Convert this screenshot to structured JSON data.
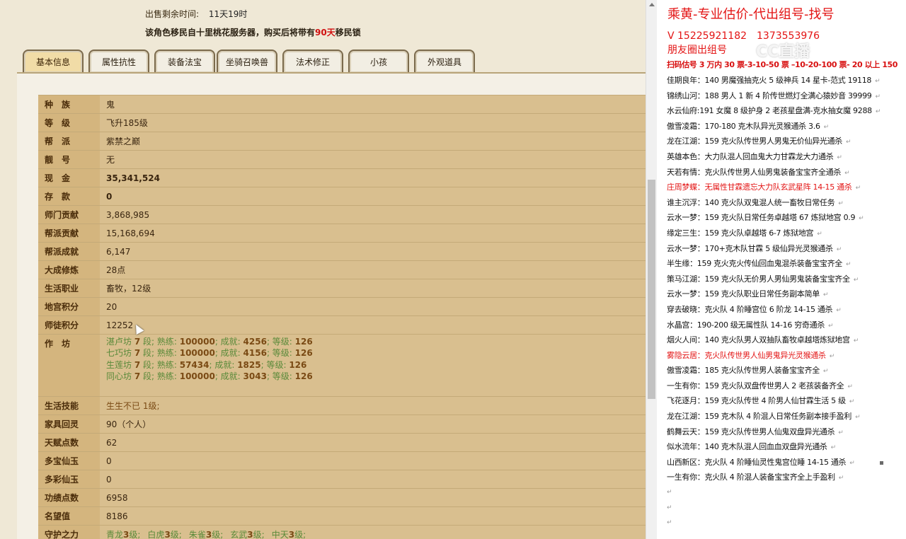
{
  "header": {
    "time_label": "出售剩余时间:",
    "time_value": "11天19时",
    "migration_prefix": "该角色移民自十里桃花服务器，购买后将带有",
    "migration_days": "90天",
    "migration_suffix": "移民锁"
  },
  "tabs": [
    "基本信息",
    "属性抗性",
    "装备法宝",
    "坐骑召唤兽",
    "法术修正",
    "小孩",
    "外观道具"
  ],
  "active_tab": 0,
  "rows": [
    {
      "key": "种　族",
      "value": "鬼"
    },
    {
      "key": "等　级",
      "value": "飞升185级"
    },
    {
      "key": "帮　派",
      "value": "紫禁之巅"
    },
    {
      "key": "靓　号",
      "value": "无"
    },
    {
      "key": "现　金",
      "value": "35,341,524"
    },
    {
      "key": "存　款",
      "value": "0"
    },
    {
      "key": "师门贡献",
      "value": "3,868,985"
    },
    {
      "key": "帮派贡献",
      "value": "15,168,694"
    },
    {
      "key": "帮派成就",
      "value": "6,147"
    },
    {
      "key": "大成修炼",
      "value": "28点"
    },
    {
      "key": "生活职业",
      "value": "畜牧，12级"
    },
    {
      "key": "地宫积分",
      "value": "20"
    },
    {
      "key": "师徒积分",
      "value": "12252"
    }
  ],
  "workshop": {
    "key": "作　坊",
    "lines": [
      {
        "name": "湛卢坊",
        "seg": "7",
        "seg_label": "段;",
        "skill_label": "熟练:",
        "skill": "100000",
        "ach_label": "成就:",
        "ach": "4256",
        "lv_label": "等级:",
        "lv": "126"
      },
      {
        "name": "七巧坊",
        "seg": "7",
        "seg_label": "段;",
        "skill_label": "熟练:",
        "skill": "100000",
        "ach_label": "成就:",
        "ach": "4156",
        "lv_label": "等级:",
        "lv": "126"
      },
      {
        "name": "生莲坊",
        "seg": "7",
        "seg_label": "段;",
        "skill_label": "熟练:",
        "skill": "57434",
        "ach_label": "成就:",
        "ach": "1825",
        "lv_label": "等级:",
        "lv": "126"
      },
      {
        "name": "同心坊",
        "seg": "7",
        "seg_label": "段;",
        "skill_label": "熟练:",
        "skill": "100000",
        "ach_label": "成就:",
        "ach": "3043",
        "lv_label": "等级:",
        "lv": "126"
      }
    ]
  },
  "rows2": [
    {
      "key": "生活技能",
      "value": "生生不已 1级;"
    },
    {
      "key": "家具回灵",
      "value": "90（个人）"
    },
    {
      "key": "天赋点数",
      "value": "62"
    },
    {
      "key": "多宝仙玉",
      "value": "0"
    },
    {
      "key": "多彩仙玉",
      "value": "0"
    },
    {
      "key": "功绩点数",
      "value": "6958"
    },
    {
      "key": "名望值",
      "value": "8186"
    }
  ],
  "guard": {
    "key": "守护之力",
    "items": [
      {
        "name": "青龙",
        "lv": "3",
        "unit": "级;"
      },
      {
        "name": "白虎",
        "lv": "3",
        "unit": "级;"
      },
      {
        "name": "朱雀",
        "lv": "3",
        "unit": "级;"
      },
      {
        "name": "玄武",
        "lv": "3",
        "unit": "级;"
      },
      {
        "name": "中天",
        "lv": "3",
        "unit": "级;"
      }
    ]
  },
  "notepad": {
    "title": "乘黄-专业估价-代出组号-找号",
    "phone": "V 15225921182　137​3553976",
    "moments": "朋友圈出组号",
    "watermark": "CC直播",
    "scan": "扫码估号 3 万内 30 票-3-10-50 票 –10-20-100 票- 20 以上 150",
    "para_mark": "↵",
    "lines": [
      {
        "text": "佳期良年：140 男魔强抽克火 5 级神兵 14 星卡-范式 19118",
        "red": false
      },
      {
        "text": "锦绣山河：188 男人 1 新 4 阶传世燃灯全满心猿妙音 39999",
        "red": false
      },
      {
        "text": "水云仙府:191 女魔 8 级护身 2 老孩星盘满-克水抽女魔 9288",
        "red": false
      },
      {
        "text": "傲雪凌霜：170-180 克木队异光灵猴通杀 3.6",
        "red": false
      },
      {
        "text": "龙在江湖：159 克火队传世男人男鬼无价仙异光通杀",
        "red": false
      },
      {
        "text": "英雄本色：大力队混人回血鬼大力甘霖龙大力通杀",
        "red": false
      },
      {
        "text": "天若有情：克火队传世男人仙男鬼装备宝宝齐全通杀",
        "red": false
      },
      {
        "text": "庄周梦蝶：无属性甘霖遗忘大力队玄武星阵 14-15 通杀",
        "red": true
      },
      {
        "text": "谁主沉浮：140 克火队双鬼混人统一畜牧日常任务",
        "red": false
      },
      {
        "text": "云水一梦：159 克火队日常任务卓越塔 67 炼狱地宫 0.9",
        "red": false
      },
      {
        "text": "缘定三生：159 克火队卓越塔 6-7 炼狱地宫",
        "red": false
      },
      {
        "text": "云水一梦：170+克木队甘霖 5 级仙异光灵猴通杀",
        "red": false
      },
      {
        "text": "半生缘：159 克火克火传仙回血鬼混杀装备宝宝齐全",
        "red": false
      },
      {
        "text": "策马江湖：159 克火队无价男人男仙男鬼装备宝宝齐全",
        "red": false
      },
      {
        "text": "云水一梦：159 克火队职业日常任务副本简单",
        "red": false
      },
      {
        "text": "穿去破晓：克火队 4 阶睡宫位 6 阶龙 14-15 通杀",
        "red": false
      },
      {
        "text": "水晶宫：190-200 级无属性队 14-16 穷奇通杀",
        "red": false
      },
      {
        "text": "烟火人间：140 克火队男人双抽队畜牧卓越塔炼狱地宫",
        "red": false
      },
      {
        "text": "雾隐云居：克火队传世男人仙男鬼异光灵猴通杀",
        "red": true
      },
      {
        "text": "傲雪凌霜：185 克火队传世男人装备宝宝齐全",
        "red": false
      },
      {
        "text": "一生有你：159 克火队双盘传世男人 2 老孩装备齐全",
        "red": false
      },
      {
        "text": "飞花逐月：159 克火队传世 4 阶男人仙甘霖生活 5 级",
        "red": false
      },
      {
        "text": "龙在江湖：159 克木队 4 阶混人日常任务副本接手盈利",
        "red": false
      },
      {
        "text": "鹤舞云天：159 克火队传世男人仙鬼双盘异光通杀",
        "red": false
      },
      {
        "text": "似水流年：140 克木队混人回血血双盘异光通杀",
        "red": false
      },
      {
        "text": "山西新区：克火队 4 阶睡仙灵性鬼宫位睡 14-15 通杀",
        "red": false
      },
      {
        "text": "一生有你：克火队 4 阶混人装备宝宝齐全上手盈利",
        "red": false
      }
    ]
  }
}
